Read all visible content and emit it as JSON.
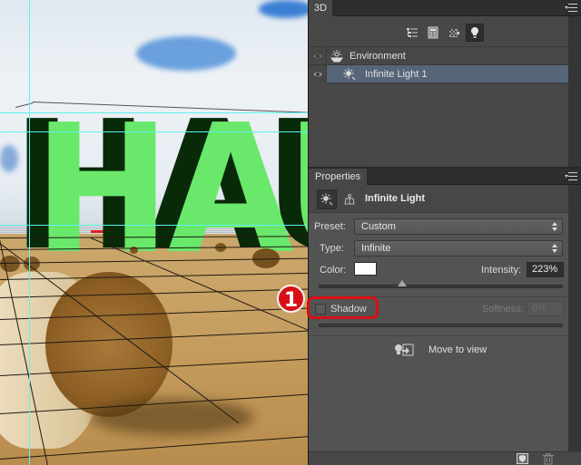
{
  "canvas": {
    "text_3d": "HAU",
    "extrusion_front_color": "#69e86b",
    "extrusion_side_color": "#092a08",
    "guide_color": "#5ff2ef"
  },
  "panel_3d": {
    "tab_label": "3D",
    "toolbar": [
      {
        "icon": "whole-scene-icon",
        "active": false
      },
      {
        "icon": "meshes-icon",
        "active": false
      },
      {
        "icon": "materials-icon",
        "active": false
      },
      {
        "icon": "lights-icon",
        "active": true
      }
    ],
    "layers": [
      {
        "label": "Environment",
        "icon": "environment-icon",
        "visible": true,
        "selected": false
      },
      {
        "label": "Infinite Light 1",
        "icon": "infinite-light-icon",
        "visible": true,
        "selected": true
      }
    ]
  },
  "properties": {
    "tab_label": "Properties",
    "header_title": "Infinite Light",
    "preset": {
      "label": "Preset:",
      "value": "Custom"
    },
    "type": {
      "label": "Type:",
      "value": "Infinite"
    },
    "color": {
      "label": "Color:",
      "value": "#ffffff"
    },
    "intensity": {
      "label": "Intensity:",
      "value": "223%",
      "slider_fraction": 0.34
    },
    "shadow": {
      "label": "Shadow",
      "checked": false
    },
    "softness": {
      "label": "Softness:",
      "value": "0%"
    },
    "move_to_view": "Move to view"
  },
  "annotation": {
    "number": "1",
    "color": "#d80f15"
  }
}
